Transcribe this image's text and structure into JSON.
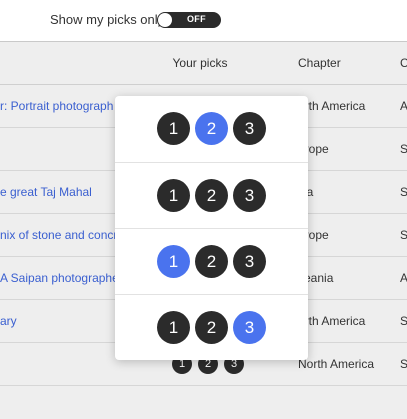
{
  "filter": {
    "label": "Show my picks only",
    "toggle_text": "OFF"
  },
  "table": {
    "headers": {
      "picks": "Your picks",
      "chapter": "Chapter",
      "extra": "C"
    },
    "rows": [
      {
        "title": "r: Portrait photograph",
        "chapter": "orth America",
        "extra": "A"
      },
      {
        "title": "",
        "chapter": "urope",
        "extra": "S"
      },
      {
        "title": "e great Taj Mahal",
        "chapter": "sia",
        "extra": "S"
      },
      {
        "title": "nix of stone and concr",
        "chapter": "urope",
        "extra": "S"
      },
      {
        "title": "A Saipan photographe",
        "chapter": "ceania",
        "extra": "A"
      },
      {
        "title": "ary",
        "chapter": "orth America",
        "extra": "S"
      },
      {
        "title": "",
        "chapter": "North America",
        "extra": "S"
      }
    ],
    "last_row_picks": [
      "1",
      "2",
      "3"
    ]
  },
  "popover": {
    "rows": [
      {
        "options": [
          "1",
          "2",
          "3"
        ],
        "selected": "2"
      },
      {
        "options": [
          "1",
          "2",
          "3"
        ],
        "selected": ""
      },
      {
        "options": [
          "1",
          "2",
          "3"
        ],
        "selected": "1"
      },
      {
        "options": [
          "1",
          "2",
          "3"
        ],
        "selected": "3"
      }
    ]
  },
  "colors": {
    "accent": "#4a73ee",
    "dark": "#2b2b2b",
    "link": "#3a5fd0"
  }
}
